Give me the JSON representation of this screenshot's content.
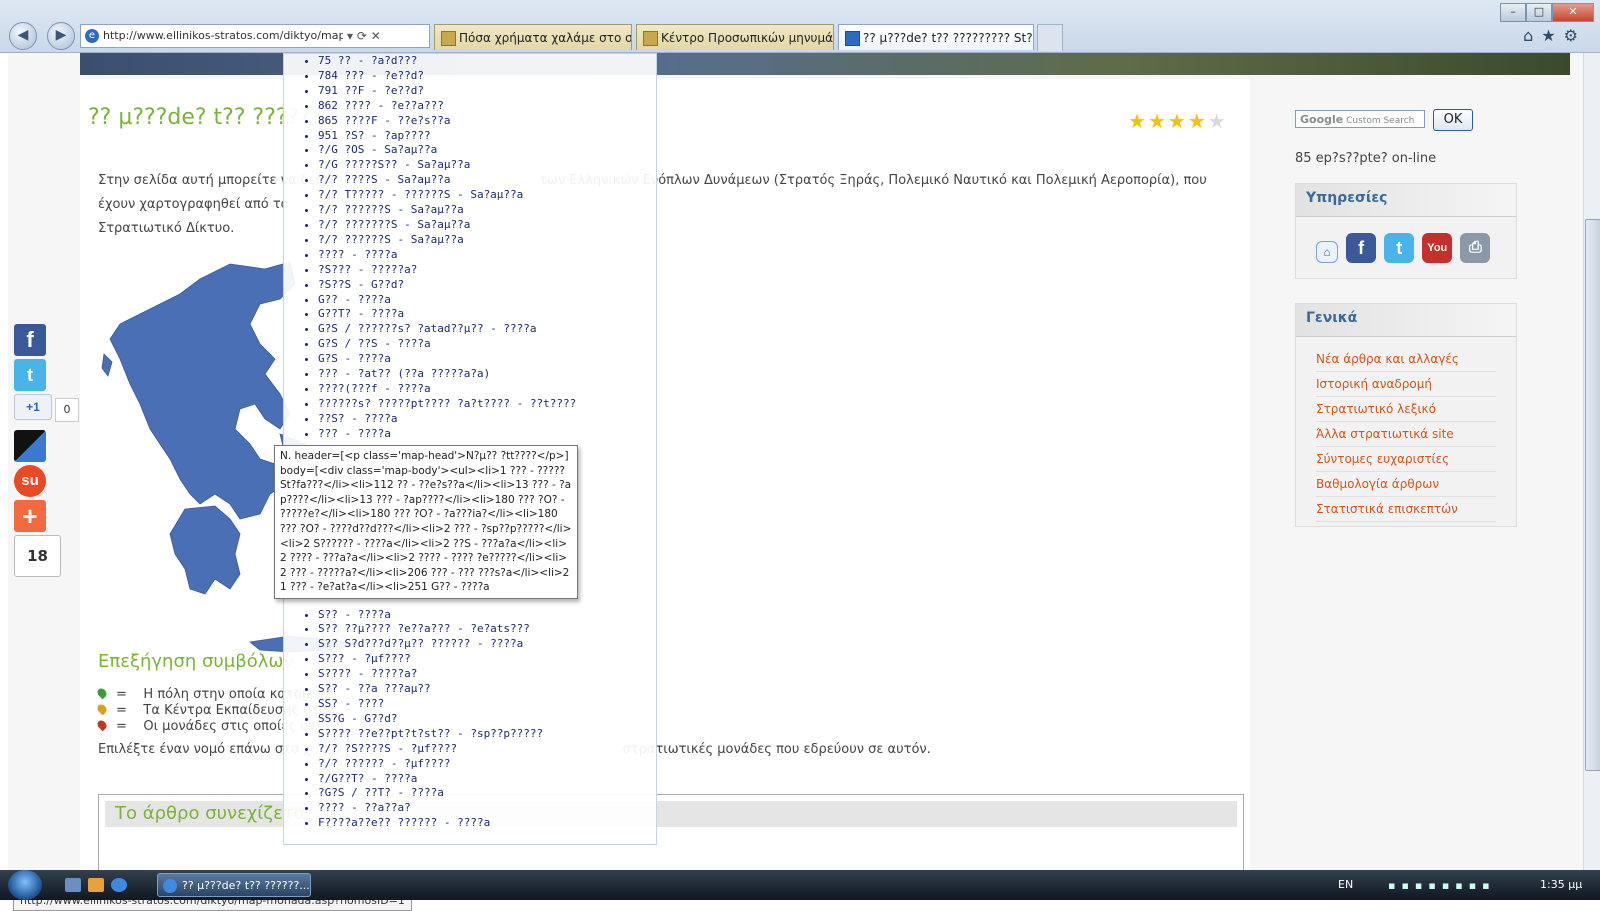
{
  "browser": {
    "address": "http://www.ellinikos-stratos.com/diktyo/map",
    "tabs": [
      {
        "title": "Πόσα χρήματα χαλάμε στο στ..."
      },
      {
        "title": "Κέντρο Προσωπικών μηνυμά..."
      },
      {
        "title": "?? µ???de? t?? ????????? St?at??"
      }
    ],
    "status_url": "http://www.ellinikos-stratos.com/diktyo/map-monada.asp?nomosID=1"
  },
  "article": {
    "title": "?? µ???de? t?? ??????",
    "rating": 4,
    "intro_1": "Στην σελίδα αυτή μπορείτε να δείτε",
    "intro_2": "των Ελληνικών Ενόπλων Δυνάμεων (Στρατός Ξηράς, Πολεμικό Ναυτικό και Πολεμική Αεροπορία), που έχουν χαρτογραφηθεί από το",
    "intro_3": "Στρατιωτικό Δίκτυο.",
    "legend_title": "Επεξήγηση συμβόλων",
    "legend": [
      {
        "text": "Η πόλη στην οποία κατοικ",
        "color": "#3d9a3d"
      },
      {
        "text": "Τα Κέντρα Εκπαίδευσης στα",
        "color": "#d6a21b"
      },
      {
        "text": "Οι μονάδες στις οποίες υπ",
        "color": "#c0392b"
      }
    ],
    "instruction_1": "Επιλέξτε έναν νομό επάνω στο χ",
    "instruction_2": "στρατιωτικές μονάδες που εδρεύουν σε αυτόν.",
    "continue_title": "Το άρθρο συνεχίζετα"
  },
  "overlay_list": [
    "75 ?? - ?a?d???",
    "784 ??? - ?e??d?",
    "791 ??F - ?e??d?",
    "862 ???? - ?e??a???",
    "865 ????F - ??e?s??a",
    "951 ?S? - ?ap????",
    "?/G ?OS - Sa?aµ??a",
    "?/G ?????S?? - Sa?aµ??a",
    "?/? ????S - Sa?aµ??a",
    "?/? T????? - ??????S - Sa?aµ??a",
    "?/? ??????S - Sa?aµ??a",
    "?/? ???????S - Sa?aµ??a",
    "?/? ??????S - Sa?aµ??a",
    "???? - ????a",
    "?S??? - ?????a?",
    "?S??S - G??d?",
    "G?? - ????a",
    "G??T? - ????a",
    "G?S / ??????s? ?atad??µ?? - ????a",
    "G?S / ??S - ????a",
    "G?S - ????a",
    "??? - ?at?? (??a ?????a?a)",
    "????(???f - ????a",
    "??????s? ?????pt???? ?a?t???? - ??t????",
    "??S? - ????a",
    "??? - ????a",
    "S?? - ????a",
    "S?? ??µ???? ?e??a??? - ?e?ats???",
    "S?? S?d???d??µ?? ?????? - ????a",
    "S??? - ?µf????",
    "S???? - ?????a?",
    "S?? - ??a ???aµ??",
    "SS? - ????",
    "SS?G - G??d?",
    "S???? ??e??pt?t?st?? - ?sp??p?????",
    "?/? ?S????S - ?µf????",
    "?/? ?????? - ?µf????",
    "?/G??T? - ????a",
    "?G?S / ??T? - ????a",
    "???? - ??a??a?",
    "F????a??e?? ?????? - ????a"
  ],
  "tooltip": "N. header=[<p class='map-head'>N?µ?? ?tt????</p>] body=[<div class='map-body'><ul><li>1 ??? - ????? St?fa???</li><li>112 ?? - ??e?s??a</li><li>13 ??? - ?ap????</li><li>13 ??? - ?ap????</li><li>180 ??? ?O? - ?????e?</li><li>180 ??? ?O? - ?a???ia?</li><li>180 ??? ?O? - ????d??d???</li><li>2 ??? - ?sp??p?????</li><li>2 S?????? - ????a</li><li>2 ??S - ???a?a</li><li>2 ???? - ???a?a</li><li>2 ???? - ???? ?e?????</li><li>2 ??? - ?????a?</li><li>206 ??? - ??? ???s?a</li><li>21 ??? - ?e?at?a</li><li>251 G?? - ????a",
  "sidebar": {
    "search_placeholder": "Custom Search",
    "search_brand": "Google",
    "search_button": "OK",
    "online": "85 ep?s??pte? on-line",
    "services_title": "Υπηρεσίες",
    "general_title": "Γενικά",
    "general_items": [
      "Νέα άρθρα και αλλαγές",
      "Ιστορική αναδρομή",
      "Στρατιωτικό λεξικό",
      "Άλλα στρατιωτικά site",
      "Σύντομες ευχαριστίες",
      "Βαθμολογία άρθρων",
      "Στατιστικά επισκεπτών"
    ]
  },
  "social": {
    "gplus_label": "+1",
    "gplus_count": "0",
    "share_count": "18"
  },
  "taskbar": {
    "task_title": "?? µ???de? t?? ??????...",
    "language": "EN",
    "clock": "1:35 µµ"
  },
  "colors": {
    "title_green": "#7bb33a",
    "link_orange": "#d1581c",
    "map_blue": "#4a6fb5"
  }
}
